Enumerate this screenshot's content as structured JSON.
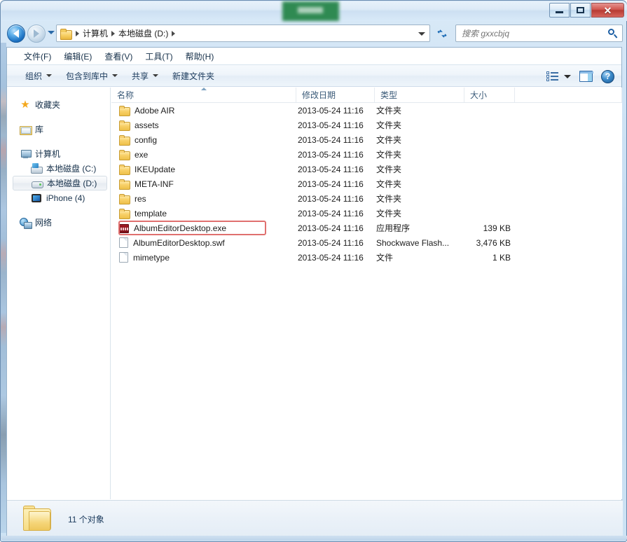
{
  "window": {
    "title_redacted": true,
    "controls": {
      "minimize_label": "—",
      "maximize_label": "□",
      "close_label": "✕"
    }
  },
  "nav": {
    "back_tooltip": "后退",
    "forward_tooltip": "前进",
    "breadcrumbs": [
      "计算机",
      "本地磁盘 (D:)"
    ],
    "refresh_label": "↺"
  },
  "search": {
    "placeholder": "搜索 gxxcbjq",
    "value": ""
  },
  "menubar": {
    "items": [
      {
        "label": "文件(F)"
      },
      {
        "label": "编辑(E)"
      },
      {
        "label": "查看(V)"
      },
      {
        "label": "工具(T)"
      },
      {
        "label": "帮助(H)"
      }
    ]
  },
  "toolbar": {
    "items": [
      {
        "label": "组织",
        "caret": true
      },
      {
        "label": "包含到库中",
        "caret": true
      },
      {
        "label": "共享",
        "caret": true
      },
      {
        "label": "新建文件夹",
        "caret": false
      }
    ],
    "help_label": "?"
  },
  "sidebar": {
    "items": [
      {
        "label": "收藏夹",
        "icon": "star-icon",
        "level": 0,
        "selected": false
      },
      {
        "label": "库",
        "icon": "library-icon",
        "level": 0,
        "selected": false
      },
      {
        "label": "计算机",
        "icon": "computer-icon",
        "level": 0,
        "selected": false
      },
      {
        "label": "本地磁盘 (C:)",
        "icon": "system-drive-icon",
        "level": 1,
        "selected": false
      },
      {
        "label": "本地磁盘 (D:)",
        "icon": "drive-icon",
        "level": 1,
        "selected": true
      },
      {
        "label": "iPhone (4)",
        "icon": "iphone-icon",
        "level": 1,
        "selected": false
      },
      {
        "label": "网络",
        "icon": "network-icon",
        "level": 0,
        "selected": false
      }
    ]
  },
  "file_list": {
    "columns": [
      {
        "key": "name",
        "label": "名称",
        "sorted": true,
        "sort_dir": "asc"
      },
      {
        "key": "date",
        "label": "修改日期",
        "sorted": false
      },
      {
        "key": "type",
        "label": "类型",
        "sorted": false
      },
      {
        "key": "size",
        "label": "大小",
        "sorted": false
      }
    ],
    "rows": [
      {
        "name": "Adobe AIR",
        "date": "2013-05-24 11:16",
        "type": "文件夹",
        "size": "",
        "icon": "folder-icon",
        "highlighted": false
      },
      {
        "name": "assets",
        "date": "2013-05-24 11:16",
        "type": "文件夹",
        "size": "",
        "icon": "folder-icon",
        "highlighted": false
      },
      {
        "name": "config",
        "date": "2013-05-24 11:16",
        "type": "文件夹",
        "size": "",
        "icon": "folder-icon",
        "highlighted": false
      },
      {
        "name": "exe",
        "date": "2013-05-24 11:16",
        "type": "文件夹",
        "size": "",
        "icon": "folder-icon",
        "highlighted": false
      },
      {
        "name": "IKEUpdate",
        "date": "2013-05-24 11:16",
        "type": "文件夹",
        "size": "",
        "icon": "folder-icon",
        "highlighted": false
      },
      {
        "name": "META-INF",
        "date": "2013-05-24 11:16",
        "type": "文件夹",
        "size": "",
        "icon": "folder-icon",
        "highlighted": false
      },
      {
        "name": "res",
        "date": "2013-05-24 11:16",
        "type": "文件夹",
        "size": "",
        "icon": "folder-icon",
        "highlighted": false
      },
      {
        "name": "template",
        "date": "2013-05-24 11:16",
        "type": "文件夹",
        "size": "",
        "icon": "folder-icon",
        "highlighted": false
      },
      {
        "name": "AlbumEditorDesktop.exe",
        "date": "2013-05-24 11:16",
        "type": "应用程序",
        "size": "139 KB",
        "icon": "exe-icon",
        "highlighted": true
      },
      {
        "name": "AlbumEditorDesktop.swf",
        "date": "2013-05-24 11:16",
        "type": "Shockwave Flash...",
        "size": "3,476 KB",
        "icon": "file-icon",
        "highlighted": false
      },
      {
        "name": "mimetype",
        "date": "2013-05-24 11:16",
        "type": "文件",
        "size": "1 KB",
        "icon": "file-icon",
        "highlighted": false
      }
    ]
  },
  "status": {
    "item_count_text": "11 个对象"
  },
  "colors": {
    "accent": "#1b5a96",
    "highlight_red": "#e0706f",
    "folder_yellow": "#f8d068",
    "exe_red": "#a01b24",
    "redaction_green": "#2f8a52",
    "title_text": "#16304a"
  }
}
